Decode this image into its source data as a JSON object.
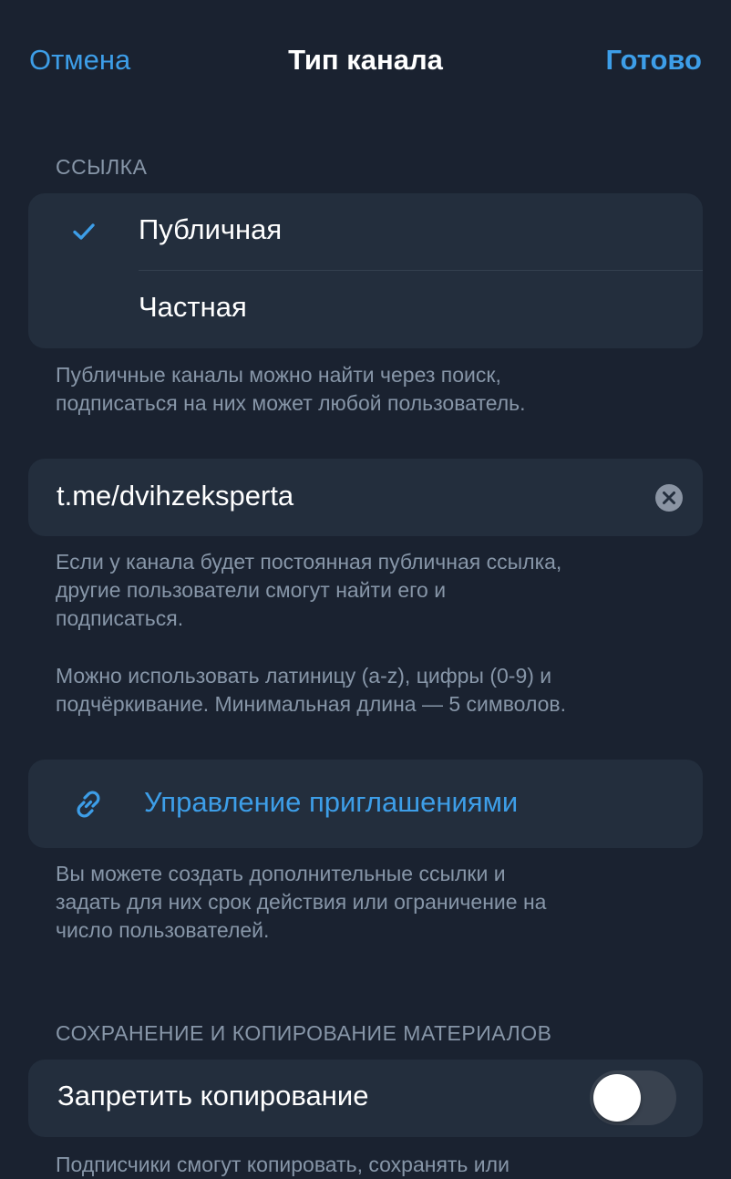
{
  "nav": {
    "cancel_label": "Отмена",
    "title": "Тип канала",
    "done_label": "Готово"
  },
  "link_section": {
    "header": "ССЫЛКА",
    "options": [
      {
        "label": "Публичная",
        "selected": true
      },
      {
        "label": "Частная",
        "selected": false
      }
    ],
    "footer": "Публичные каналы можно найти через поиск,\nподписаться на них может любой пользователь."
  },
  "link_field": {
    "value": "t.me/dvihzeksperta",
    "footer_1": "Если у канала будет постоянная публичная ссылка,\nдругие пользователи смогут найти его и\nподписаться.",
    "footer_2": "Можно использовать латиницу (a-z), цифры (0-9) и\nподчёркивание. Минимальная длина — 5 символов."
  },
  "invites": {
    "label": "Управление приглашениями",
    "icon": "link-icon",
    "footer": "Вы можете создать дополнительные ссылки и\nзадать для них срок действия или ограничение на\nчисло пользователей."
  },
  "content_section": {
    "header": "СОХРАНЕНИЕ И КОПИРОВАНИЕ МАТЕРИАЛОВ",
    "restrict_label": "Запретить копирование",
    "restrict_enabled": false,
    "footer": "Подписчики смогут копировать, сохранять или"
  },
  "colors": {
    "background": "#1a2230",
    "card": "#232e3d",
    "accent": "#3d9ee8",
    "secondary_text": "#8796a8"
  }
}
